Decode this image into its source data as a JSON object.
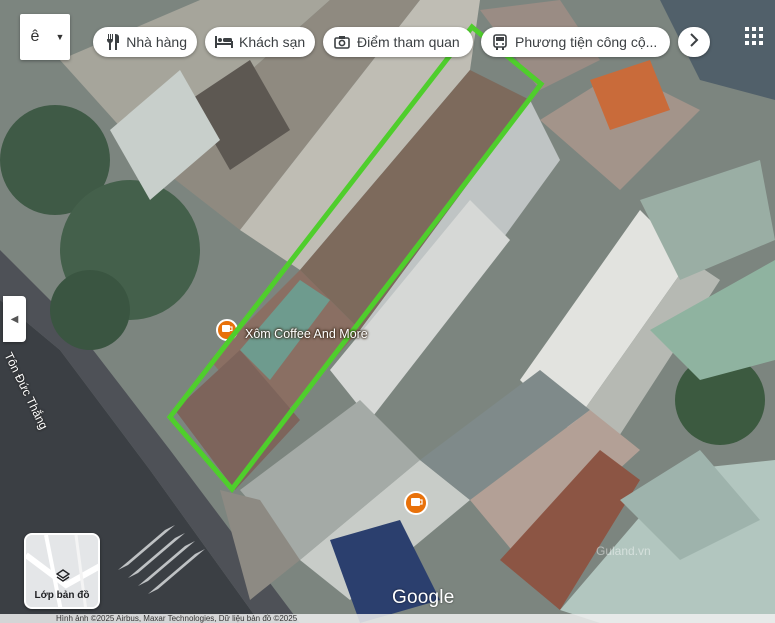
{
  "search": {
    "language_value": "ê"
  },
  "chips": [
    {
      "label": "Nhà hàng",
      "icon": "restaurant-icon"
    },
    {
      "label": "Khách sạn",
      "icon": "hotel-icon"
    },
    {
      "label": "Điểm tham quan",
      "icon": "camera-icon"
    },
    {
      "label": "Phương tiện công cộ...",
      "icon": "transit-icon"
    }
  ],
  "map": {
    "poi_name": "Xôm Coffee And More",
    "road_name": "Tôn Đức Thắng",
    "logo_text": "Google",
    "watermark": "Guland.vn",
    "footer_text": "Hình ảnh ©2025 Airbus, Maxar Technologies, Dữ liệu bản đồ ©2025",
    "highlight_color": "#4fce2c"
  },
  "layers": {
    "label": "Lớp bản đồ"
  }
}
